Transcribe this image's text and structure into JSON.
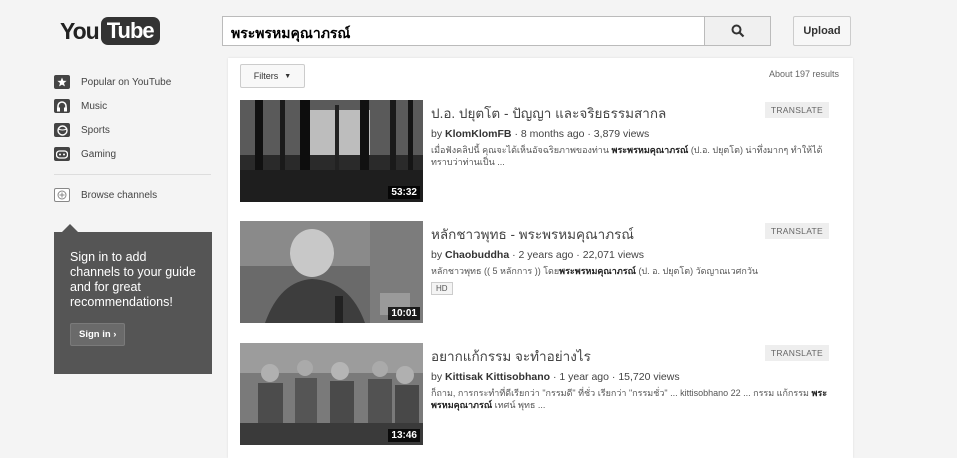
{
  "header": {
    "logo_you": "You",
    "logo_tube": "Tube",
    "search_query": "พระพรหมคุณาภรณ์",
    "upload_label": "Upload"
  },
  "guide": {
    "items": [
      {
        "label": "Popular on YouTube",
        "icon": "star-icon"
      },
      {
        "label": "Music",
        "icon": "headphones-icon"
      },
      {
        "label": "Sports",
        "icon": "ball-icon"
      },
      {
        "label": "Gaming",
        "icon": "gamepad-icon"
      }
    ],
    "browse_label": "Browse channels",
    "signin_text": "Sign in to add channels to your guide and for great recommendations!",
    "signin_button": "Sign in ›"
  },
  "results_header": {
    "filters_label": "Filters",
    "result_count": "About 197 results"
  },
  "results": [
    {
      "title": "ป.อ. ปยุตโต - ปัญญา และจริยธรรมสากล",
      "by": "by",
      "channel": "KlomKlomFB",
      "meta": "· 8 months ago · 3,879 views",
      "desc_pre": "เมื่อฟังคลิปนี้ คุณจะได้เห็นอัจฉริยภาพของท่าน ",
      "desc_bold": "พระพรหมคุณาภรณ์",
      "desc_post": " (ป.อ. ปยุตโต) น่าทึ่งมากๆ ทำให้ได้ทราบว่าท่านเป็น ...",
      "duration": "53:32",
      "translate": "TRANSLATE"
    },
    {
      "title": "หลักชาวพุทธ - พระพรหมคุณาภรณ์",
      "by": "by",
      "channel": "Chaobuddha",
      "meta": "· 2 years ago · 22,071 views",
      "desc_pre": "หลักชาวพุทธ (( 5 หลักการ )) โดย",
      "desc_bold": "พระพรหมคุณาภรณ์",
      "desc_post": " (ป. อ. ปยุตโต) วัดญาณเวศกวัน",
      "badge": "HD",
      "duration": "10:01",
      "translate": "TRANSLATE"
    },
    {
      "title": "อยากแก้กรรม จะทำอย่างไร",
      "by": "by",
      "channel": "Kittisak Kittisobhano",
      "meta": "· 1 year ago · 15,720 views",
      "desc_pre": "ก็ถาม, การกระทำที่ดีเรียกว่า \"กรรมดี\" ที่ชั่ว เรียกว่า \"กรรมชั่ว\" ... kittisobhano 22 ... กรรม แก้กรรม ",
      "desc_bold": "พระพรหมคุณาภรณ์",
      "desc_post": " เทศน์ พุทธ ...",
      "duration": "13:46",
      "translate": "TRANSLATE"
    }
  ]
}
